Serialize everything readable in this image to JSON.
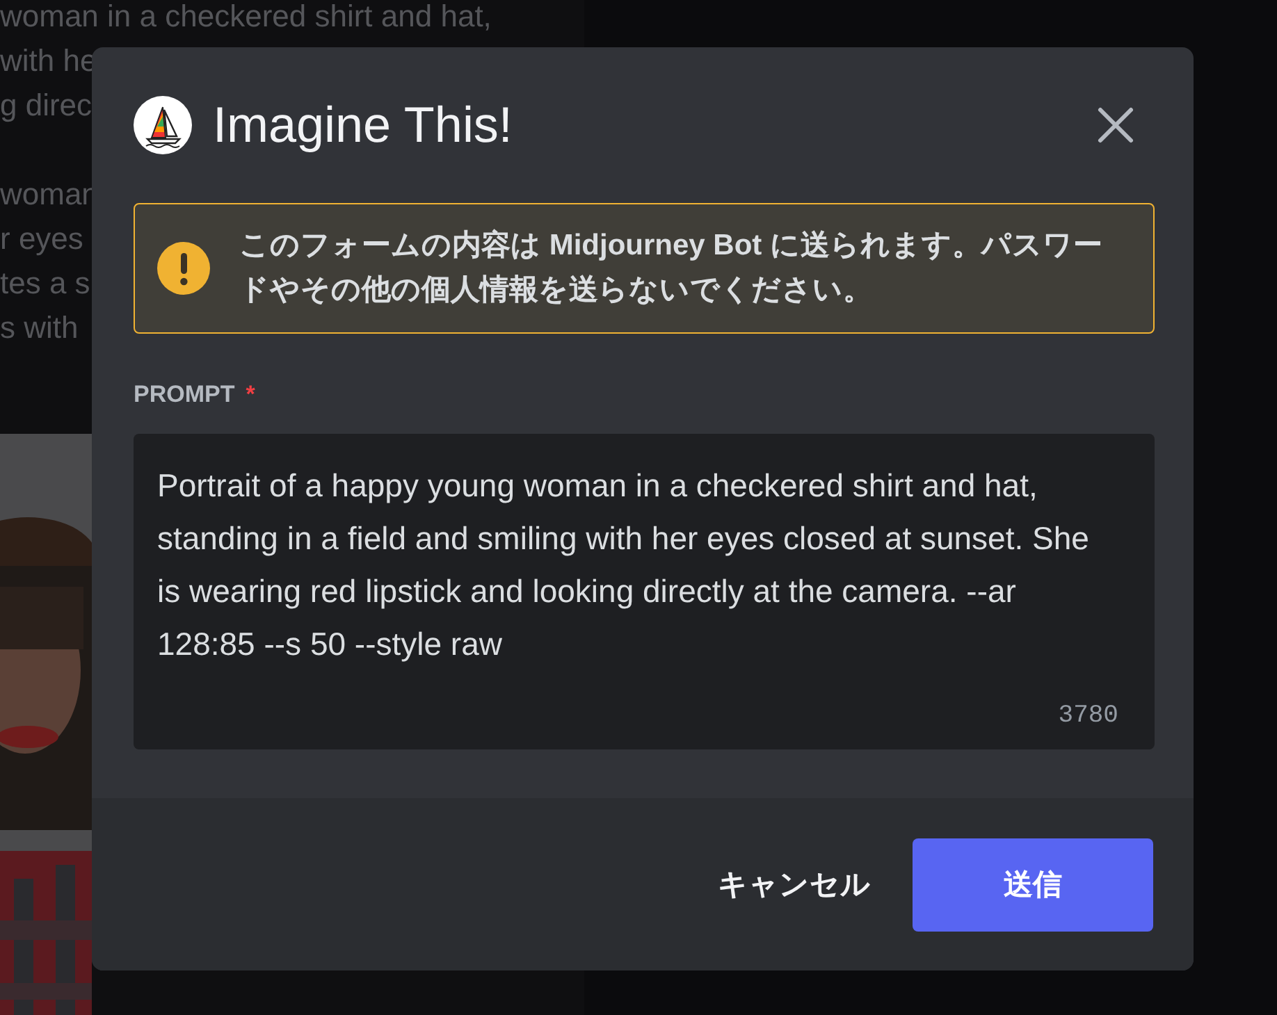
{
  "background": {
    "paragraphs": [
      [
        "woman in a checkered shirt and hat,",
        "with he",
        "g direc"
      ],
      [
        "woman",
        "r eyes",
        "tes a s",
        "s with"
      ]
    ],
    "image": {
      "kind": "picture"
    }
  },
  "dialog": {
    "title": "Imagine This!",
    "notice": {
      "kind": "warning",
      "text": "このフォームの内容は Midjourney Bot に送られます。パスワードやその他の個人情報を送らないでください。"
    },
    "field": {
      "label": "PROMPT",
      "required_mark": "*",
      "value": "Portrait of a happy young woman in a checkered shirt and hat, standing in a field and smiling with her eyes closed at sunset. She is wearing red lipstick and looking directly at the camera. --ar 128:85 --s 50 --style raw",
      "counter": "3780"
    },
    "buttons": [
      {
        "label": "キャンセル",
        "kind": "link"
      },
      {
        "label": "送信",
        "kind": "primary"
      }
    ]
  }
}
